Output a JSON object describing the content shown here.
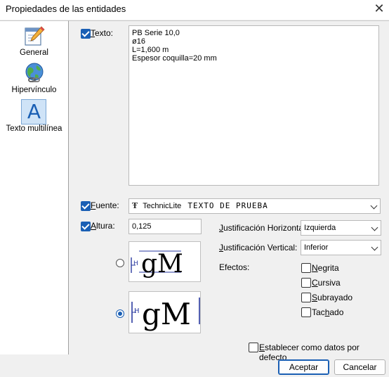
{
  "window": {
    "title": "Propiedades de las entidades",
    "close_glyph": "✕"
  },
  "sidebar": {
    "items": [
      {
        "label": "General",
        "icon": "pencil-sheet-icon"
      },
      {
        "label": "Hipervínculo",
        "icon": "globe-link-icon"
      },
      {
        "label": "Texto multilínea",
        "icon": "letter-a-icon",
        "glyph": "A"
      }
    ]
  },
  "texto": {
    "label_key": "T",
    "label_rest": "exto:",
    "checked": true,
    "content": "PB Serie 10,0\nø16\nL=1,600 m\nEspesor coquilla=20 mm"
  },
  "fuente": {
    "label_key": "F",
    "label_rest": "uente:",
    "checked": true,
    "font_name": "TechnicLite",
    "sample": "Texto de prueba",
    "font_icon": "truetype-icon"
  },
  "altura": {
    "label_key": "A",
    "label_rest": "ltura:",
    "checked": true,
    "value": "0,125"
  },
  "preview": {
    "glyphs": "gM",
    "marker": "H"
  },
  "justificacion_h": {
    "label_key": "J",
    "label_rest": "ustificación Horizontal:",
    "value": "Izquierda"
  },
  "justificacion_v": {
    "label_key": "J",
    "label_rest": "ustificación Vertical:",
    "value": "Inferior"
  },
  "efectos": {
    "label": "Efectos:",
    "items": [
      {
        "key": "N",
        "rest": "egrita",
        "checked": false
      },
      {
        "key": "C",
        "rest": "ursiva",
        "checked": false
      },
      {
        "key": "S",
        "rest": "ubrayado",
        "checked": false
      },
      {
        "key": "h",
        "pre": "Tac",
        "rest": "ado",
        "checked": false
      }
    ]
  },
  "default_option": {
    "key": "E",
    "rest": "stablecer como datos por defecto",
    "checked": false
  },
  "buttons": {
    "ok": "Aceptar",
    "cancel": "Cancelar"
  },
  "colors": {
    "accent": "#1a5fb4",
    "background": "#f0f0f0"
  }
}
